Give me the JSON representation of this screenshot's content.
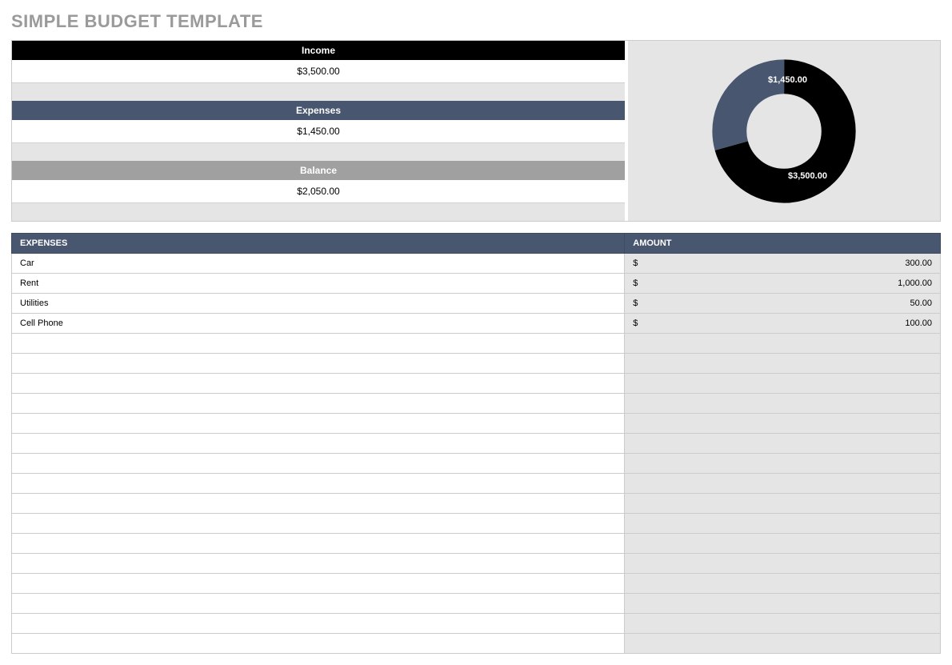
{
  "title": "SIMPLE BUDGET TEMPLATE",
  "summary": {
    "income_label": "Income",
    "income_value": "$3,500.00",
    "expenses_label": "Expenses",
    "expenses_value": "$1,450.00",
    "balance_label": "Balance",
    "balance_value": "$2,050.00"
  },
  "chart_data": {
    "type": "pie",
    "title": "",
    "series": [
      {
        "name": "Income",
        "value": 3500.0,
        "label": "$3,500.00",
        "color": "#000000"
      },
      {
        "name": "Expenses",
        "value": 1450.0,
        "label": "$1,450.00",
        "color": "#49566f"
      }
    ]
  },
  "table": {
    "headers": {
      "expenses": "EXPENSES",
      "amount": "AMOUNT"
    },
    "currency": "$",
    "rows": [
      {
        "name": "Car",
        "amount": "300.00"
      },
      {
        "name": "Rent",
        "amount": "1,000.00"
      },
      {
        "name": "Utilities",
        "amount": "50.00"
      },
      {
        "name": "Cell Phone",
        "amount": "100.00"
      }
    ],
    "blank_rows": 16
  }
}
